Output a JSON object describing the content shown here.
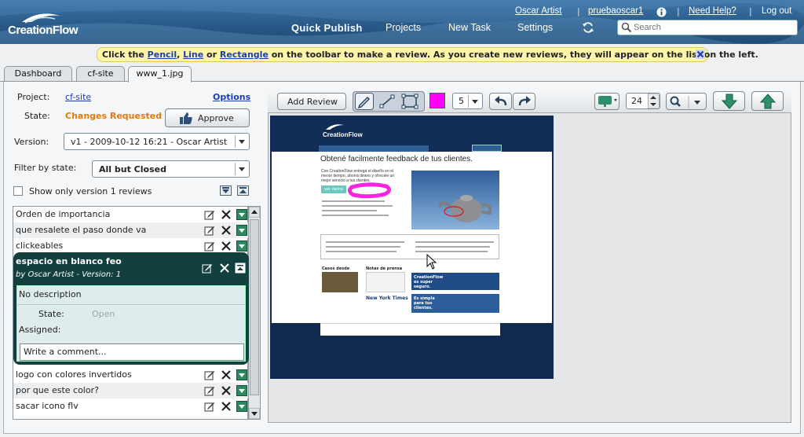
{
  "header": {
    "logo_text": "CreationFlow",
    "user_name": "Oscar Artist",
    "account": "pruebaoscar1",
    "help": "Need Help?",
    "logout": "Log out",
    "nav": {
      "quick_publish": "Quick Publish",
      "projects": "Projects",
      "new_task": "New Task",
      "settings": "Settings"
    },
    "search_placeholder": "Search"
  },
  "notice": {
    "prefix": "Click the ",
    "pencil": "Pencil",
    "comma": ", ",
    "line": "Line",
    "or": " or ",
    "rectangle": "Rectangle",
    "suffix": " on the toolbar to make a review. As you create new reviews, they will appear on the list on the left."
  },
  "tabs": [
    "Dashboard",
    "cf-site",
    "www_1.jpg"
  ],
  "left": {
    "project_label": "Project:",
    "project_value": "cf-site",
    "options": "Options",
    "state_label": "State:",
    "state_value": "Changes Requested",
    "approve": "Approve",
    "version_label": "Version:",
    "version_value": "v1 - 2009-10-12 16:21 - Oscar Artist",
    "filter_label": "Filter by state:",
    "filter_value": "All but Closed",
    "show_only": "Show only version 1 reviews",
    "reviews_top": [
      "Orden de importancia",
      "que resalete el paso donde va",
      "clickeables"
    ],
    "expanded": {
      "title": "espacio en blanco feo",
      "by": "by Oscar Artist - Version: 1",
      "description": "No description",
      "state_label": "State:",
      "state_value": "Open",
      "assigned_label": "Assigned:",
      "comment_placeholder": "Write a comment..."
    },
    "reviews_bottom": [
      "logo con colores invertidos",
      "por que este color?",
      "sacar icono flv"
    ]
  },
  "toolbar": {
    "add_review": "Add Review",
    "stroke_size": "5",
    "zoom": "24",
    "colors": {
      "pen": "#ff00ff",
      "accent_green": "#2f8f6a"
    }
  },
  "preview": {
    "brand": "CreationFlow",
    "headline": "Obtené facilmente feedback de tus clientes.",
    "intro": "Con CreationFlow entregá el diseño en el menor tiempo, ahorrá dinero y ofrecele un mejor servicio a tus clientes.",
    "cta": "ver demo",
    "casos": "Casos desde",
    "notas": "Notas de prensa",
    "nyt": "New York Times",
    "super": "CreationFlow es super seguro.",
    "simple": "Es simple para tus clientes."
  }
}
